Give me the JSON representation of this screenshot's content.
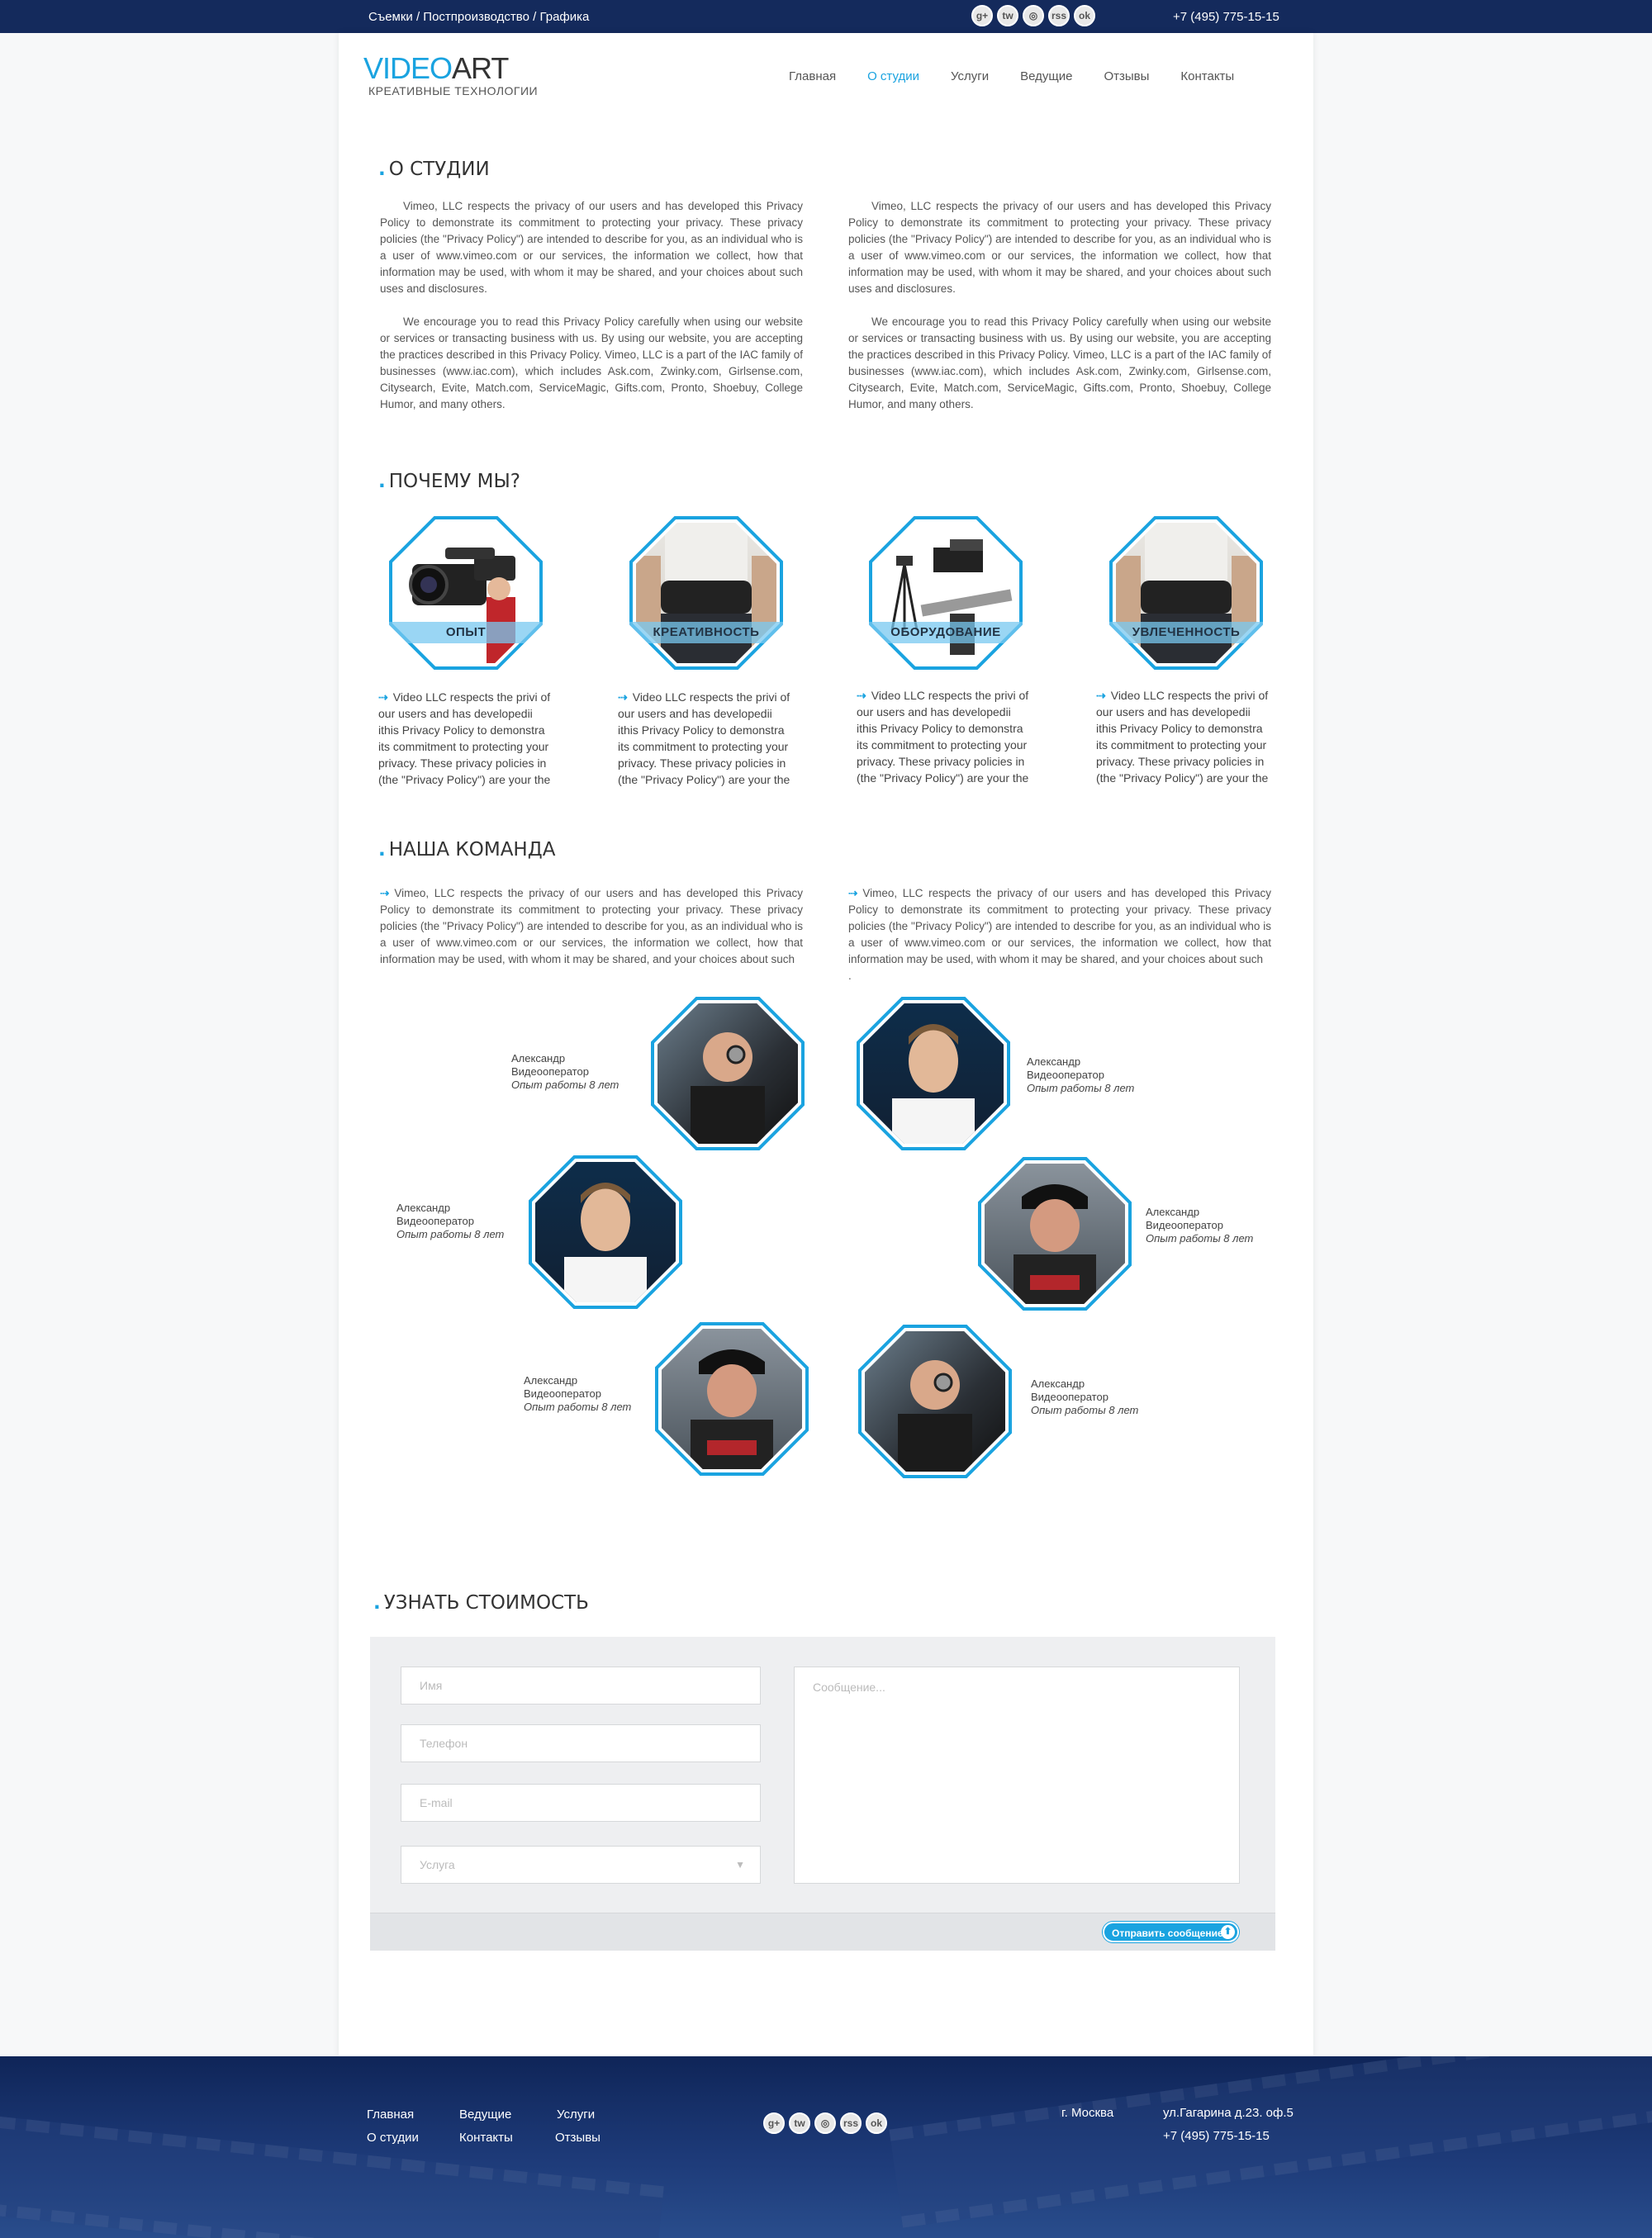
{
  "topbar": {
    "tagline": "Съемки / Постпроизводство / Графика",
    "phone": "+7 (495) 775-15-15",
    "social": [
      "g+",
      "tw",
      "◎",
      "rss",
      "ok"
    ]
  },
  "logo": {
    "video": "VIDEO",
    "art": "ART",
    "subtitle": "КРЕАТИВНЫЕ ТЕХНОЛОГИИ"
  },
  "nav": [
    "Главная",
    "О студии",
    "Услуги",
    "Ведущие",
    "Отзывы",
    "Контакты"
  ],
  "nav_active": "О студии",
  "about": {
    "title": "О СТУДИИ",
    "p1": "Vimeo, LLC respects the privacy of our users and has developed this Privacy Policy to demonstrate its commitment to protecting your privacy. These privacy policies (the \"Privacy Policy\") are intended to describe for you, as an individual who is a user of www.vimeo.com or our services, the information we collect, how that information may be used, with whom it may be shared, and your choices about such uses and disclosures.",
    "p2": "We encourage you to read this Privacy Policy carefully when using our website or services or transacting business with us. By using our website, you are accepting the practices described in this Privacy Policy. Vimeo, LLC is a part of the IAC family of businesses (www.iac.com), which includes Ask.com, Zwinky.com, Girlsense.com, Citysearch, Evite, Match.com, ServiceMagic, Gifts.com, Pronto, Shoebuy, College Humor, and many others."
  },
  "why": {
    "title": "ПОЧЕМУ МЫ?",
    "items": [
      {
        "label": "ОПЫТ",
        "icon": "camcorder-icon",
        "text": "Video LLC respects the privi of our users and has developedii ithis Privacy Policy to demonstra its commitment to protecting your privacy. These privacy policies in (the \"Privacy Policy\") are your the"
      },
      {
        "label": "КРЕАТИВНОСТЬ",
        "icon": "operator-photo",
        "text": "Video LLC respects the privi of our users and has developedii ithis Privacy Policy to demonstra its commitment to protecting your privacy. These privacy policies in (the \"Privacy Policy\") are your the"
      },
      {
        "label": "ОБОРУДОВАНИЕ",
        "icon": "tripod-icon",
        "text": "Video LLC respects the privi of our users and has developedii ithis Privacy Policy to demonstra its commitment to protecting your privacy. These privacy policies in (the \"Privacy Policy\") are your the"
      },
      {
        "label": "УВЛЕЧЕННОСТЬ",
        "icon": "operator-photo",
        "text": "Video LLC respects the privi of our users and has developedii ithis Privacy Policy to demonstra its commitment to protecting your privacy. These privacy policies in (the \"Privacy Policy\") are your the"
      }
    ]
  },
  "team": {
    "title": "НАША КОМАНДА",
    "text": "Vimeo, LLC respects the privacy of our users and has developed this Privacy Policy to demonstrate its commitment to protecting your privacy. These privacy policies (the \"Privacy Policy\") are intended to describe for you, as an individual who is a user of www.vimeo.com or our services, the information we collect, how that information may be used, with whom it may be shared, and your choices about such",
    "text_right_tail": ".",
    "members": [
      {
        "name": "Александр",
        "role": "Видеооператор",
        "exp": "Опыт работы 8 лет"
      },
      {
        "name": "Александр",
        "role": "Видеооператор",
        "exp": "Опыт работы 8 лет"
      },
      {
        "name": "Александр",
        "role": "Видеооператор",
        "exp": "Опыт работы 8 лет"
      },
      {
        "name": "Александр",
        "role": "Видеооператор",
        "exp": "Опыт работы 8 лет"
      },
      {
        "name": "Александр",
        "role": "Видеооператор",
        "exp": "Опыт работы 8 лет"
      },
      {
        "name": "Александр",
        "role": "Видеооператор",
        "exp": "Опыт работы 8 лет"
      }
    ]
  },
  "price": {
    "title": "УЗНАТЬ СТОИМОСТЬ",
    "name_placeholder": "Имя",
    "phone_placeholder": "Телефон",
    "email_placeholder": "E-mail",
    "service_placeholder": "Услуга",
    "message_placeholder": "Сообщение...",
    "send_label": "Отправить сообщение"
  },
  "footer": {
    "links_col1": [
      "Главная",
      "О студии"
    ],
    "links_col2": [
      "Ведущие",
      "Контакты"
    ],
    "links_col3": [
      "Услуги",
      "Отзывы"
    ],
    "city": "г. Москва",
    "address": "ул.Гагарина д.23. оф.5",
    "phone": "+7 (495) 775-15-15"
  },
  "colors": {
    "accent": "#1aa3e0",
    "topbar": "#142a5c",
    "footer": "#1d3a78"
  }
}
